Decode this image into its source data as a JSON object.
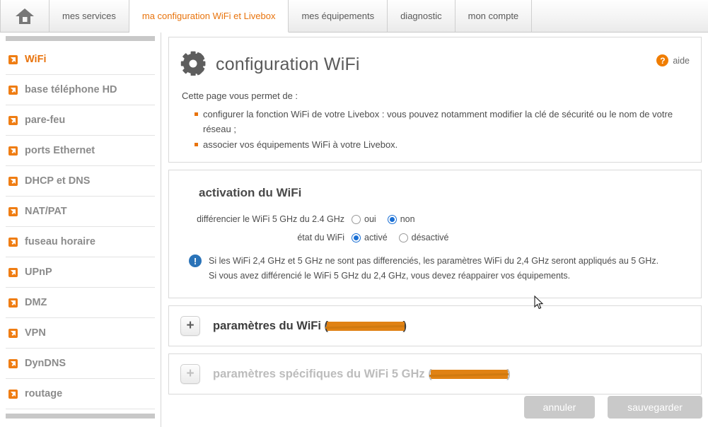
{
  "tabs": [
    {
      "label": "",
      "icon": "home-icon",
      "active": false,
      "name": "tab-home"
    },
    {
      "label": "mes services",
      "active": false,
      "name": "tab-mes-services"
    },
    {
      "label": "ma configuration WiFi et Livebox",
      "active": true,
      "name": "tab-ma-configuration-wifi-et-livebox"
    },
    {
      "label": "mes équipements",
      "active": false,
      "name": "tab-mes-equipements"
    },
    {
      "label": "diagnostic",
      "active": false,
      "name": "tab-diagnostic"
    },
    {
      "label": "mon compte",
      "active": false,
      "name": "tab-mon-compte"
    }
  ],
  "sidebar": {
    "items": [
      {
        "label": "WiFi",
        "active": true
      },
      {
        "label": "base téléphone HD",
        "active": false
      },
      {
        "label": "pare-feu",
        "active": false
      },
      {
        "label": "ports Ethernet",
        "active": false
      },
      {
        "label": "DHCP et DNS",
        "active": false
      },
      {
        "label": "NAT/PAT",
        "active": false
      },
      {
        "label": "fuseau horaire",
        "active": false
      },
      {
        "label": "UPnP",
        "active": false
      },
      {
        "label": "DMZ",
        "active": false
      },
      {
        "label": "VPN",
        "active": false
      },
      {
        "label": "DynDNS",
        "active": false
      },
      {
        "label": "routage",
        "active": false
      }
    ]
  },
  "page": {
    "title": "configuration WiFi",
    "help_label": "aide",
    "help_symbol": "?",
    "lead": "Cette page vous permet de :",
    "bullets": [
      "configurer la fonction WiFi de votre Livebox : vous pouvez notamment modifier la clé de sécurité ou le nom de votre réseau ;",
      "associer vos équipements WiFi à votre Livebox."
    ]
  },
  "activation": {
    "section_title": "activation du WiFi",
    "rows": [
      {
        "label": "différencier le WiFi 5 GHz du 2.4 GHz",
        "options": [
          {
            "label": "oui",
            "selected": false
          },
          {
            "label": "non",
            "selected": true
          }
        ]
      },
      {
        "label": "état du WiFi",
        "options": [
          {
            "label": "activé",
            "selected": true
          },
          {
            "label": "désactivé",
            "selected": false
          }
        ]
      }
    ],
    "note_symbol": "!",
    "note_line1": "Si les WiFi 2,4 GHz et 5 GHz ne sont pas differenciés, les paramètres WiFi du 2,4 GHz seront appliqués au 5 GHz.",
    "note_line2": "Si vous avez différencié le WiFi 5 GHz du 2,4 GHz, vous devez réappairer vos équipements."
  },
  "sections": [
    {
      "prefix": "paramètres du WiFi (",
      "redacted": "SSID masqué",
      "suffix": ")",
      "toggle": "+",
      "disabled": false
    },
    {
      "prefix": "paramètres spécifiques du WiFi 5 GHz (",
      "redacted": "SSID masqué",
      "suffix": ")",
      "toggle": "+",
      "disabled": true
    }
  ],
  "footer": {
    "cancel_label": "annuler",
    "save_label": "sauvegarder"
  },
  "colors": {
    "accent": "#e8730c",
    "orange_icon": "#ef7d13",
    "radio_blue": "#1a6fd4",
    "info_blue": "#2a73b8",
    "redaction": "#e08214",
    "button_gray": "#c9c9c9"
  }
}
